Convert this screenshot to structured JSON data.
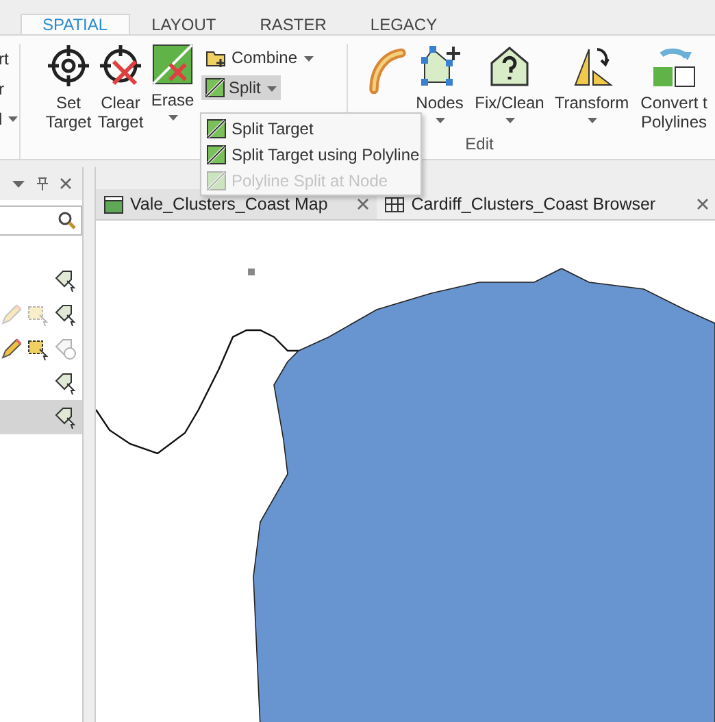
{
  "tabs": [
    {
      "label": "SPATIAL",
      "selected": true
    },
    {
      "label": "LAYOUT",
      "selected": false
    },
    {
      "label": "RASTER",
      "selected": false
    },
    {
      "label": "LEGACY",
      "selected": false
    }
  ],
  "ribbon": {
    "cut_labels": [
      "rt",
      "r",
      "l"
    ],
    "tools": [
      {
        "kind": "large",
        "label": "Set Target",
        "menu": false
      },
      {
        "kind": "large",
        "label": "Clear Target",
        "menu": false
      },
      {
        "kind": "large",
        "label": "Erase",
        "menu": true
      },
      {
        "kind": "small",
        "label": "Combine",
        "menu": true,
        "selected": false
      },
      {
        "kind": "small",
        "label": "Split",
        "menu": true,
        "selected": true
      }
    ],
    "edit_tools": [
      {
        "label": "Nodes",
        "menu": true
      },
      {
        "label": "Fix/Clean",
        "menu": true
      },
      {
        "label": "Transform",
        "menu": true
      },
      {
        "label": "Convert t\nPolylines",
        "menu": false
      }
    ],
    "group_label": "Edit"
  },
  "split_menu": [
    {
      "label": "Split Target",
      "disabled": false
    },
    {
      "label": "Split Target using Polyline",
      "disabled": false
    },
    {
      "label": "Polyline Split at Node",
      "disabled": true
    }
  ],
  "side_pane": {
    "rows": [
      {
        "selected": false
      },
      {
        "selected": false
      },
      {
        "selected": false
      },
      {
        "selected": false
      },
      {
        "selected": true
      }
    ]
  },
  "views": [
    {
      "title": "Vale_Clusters_Coast Map",
      "kind": "map"
    },
    {
      "title": "Cardiff_Clusters_Coast Browser",
      "kind": "browser"
    }
  ]
}
